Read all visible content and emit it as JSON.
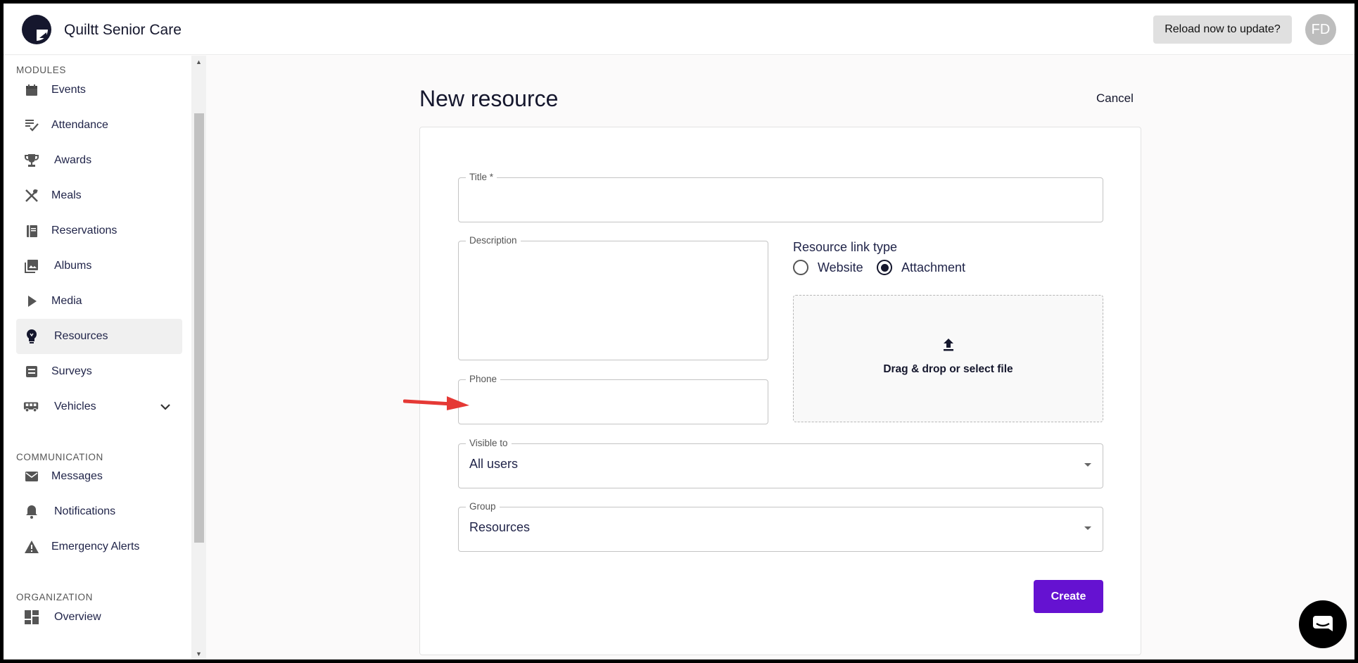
{
  "header": {
    "app_title": "Quiltt Senior Care",
    "reload_label": "Reload now to update?",
    "avatar_initials": "FD"
  },
  "sidebar": {
    "sections": {
      "modules": "MODULES",
      "communication": "COMMUNICATION",
      "organization": "ORGANIZATION"
    },
    "items": [
      {
        "label": "Events",
        "icon": "calendar-icon"
      },
      {
        "label": "Attendance",
        "icon": "checklist-icon"
      },
      {
        "label": "Awards",
        "icon": "trophy-icon"
      },
      {
        "label": "Meals",
        "icon": "utensils-icon"
      },
      {
        "label": "Reservations",
        "icon": "book-icon"
      },
      {
        "label": "Albums",
        "icon": "photo-album-icon"
      },
      {
        "label": "Media",
        "icon": "play-icon"
      },
      {
        "label": "Resources",
        "icon": "lightbulb-icon",
        "active": true
      },
      {
        "label": "Surveys",
        "icon": "survey-icon"
      },
      {
        "label": "Vehicles",
        "icon": "bus-icon",
        "expandable": true
      },
      {
        "label": "Messages",
        "icon": "mail-icon"
      },
      {
        "label": "Notifications",
        "icon": "bell-icon"
      },
      {
        "label": "Emergency Alerts",
        "icon": "warning-icon"
      },
      {
        "label": "Overview",
        "icon": "dashboard-icon"
      }
    ]
  },
  "main": {
    "page_title": "New resource",
    "cancel_label": "Cancel",
    "form": {
      "title_label": "Title *",
      "title_value": "",
      "description_label": "Description",
      "description_value": "",
      "phone_label": "Phone",
      "phone_value": "",
      "link_type_label": "Resource link type",
      "link_type_options": [
        "Website",
        "Attachment"
      ],
      "link_type_selected": "Attachment",
      "dropzone_text": "Drag & drop or select file",
      "visible_to_label": "Visible to",
      "visible_to_value": "All users",
      "group_label": "Group",
      "group_value": "Resources",
      "create_label": "Create"
    }
  },
  "colors": {
    "primary": "#6512d1",
    "navy": "#15172d",
    "annotation_arrow": "#e53935"
  }
}
